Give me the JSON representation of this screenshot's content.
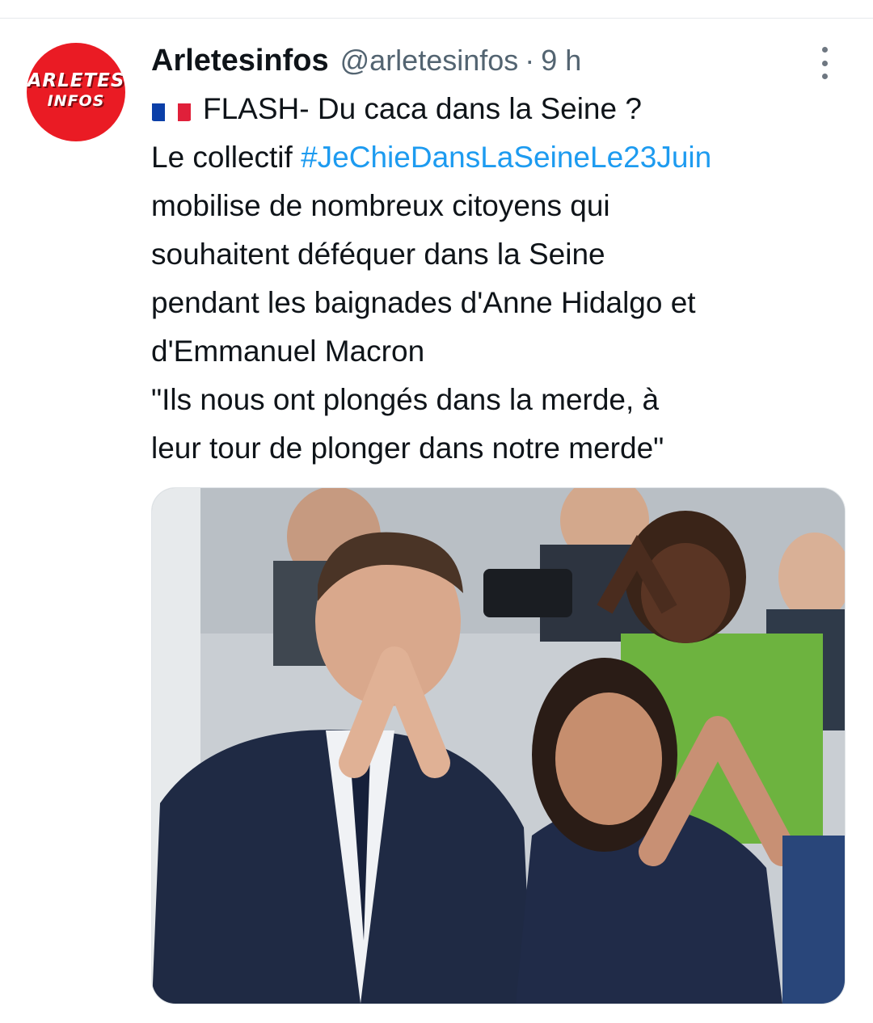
{
  "tweet": {
    "author_name": "Arletesinfos",
    "handle": "@arletesinfos",
    "separator": "·",
    "time_ago": "9 h",
    "avatar": {
      "line1": "ARLETES",
      "line2": "INFOS",
      "color": "#ea1b24"
    },
    "flag": "french-flag",
    "lines": [
      {
        "parts": [
          {
            "text": "FLASH- Du caca dans la Seine ?"
          }
        ]
      },
      {
        "parts": [
          {
            "text": "Le collectif "
          },
          {
            "text": "#JeChieDansLaSeineLe23Juin",
            "hashtag": true
          }
        ]
      },
      {
        "parts": [
          {
            "text": "mobilise de nombreux citoyens qui"
          }
        ]
      },
      {
        "parts": [
          {
            "text": "souhaitent déféquer dans la Seine"
          }
        ]
      },
      {
        "parts": [
          {
            "text": "pendant les baignades d'Anne Hidalgo et"
          }
        ]
      },
      {
        "parts": [
          {
            "text": "d'Emmanuel Macron"
          }
        ]
      },
      {
        "parts": [
          {
            "text": "\"Ils nous ont plongés dans la merde, à"
          }
        ]
      },
      {
        "parts": [
          {
            "text": "leur tour de plonger dans notre merde\""
          }
        ]
      }
    ],
    "media": {
      "kind": "photo"
    }
  },
  "colors": {
    "text": "#0f1419",
    "secondary": "#536471",
    "link": "#1d9bf0",
    "divider": "#e6e9ec"
  }
}
